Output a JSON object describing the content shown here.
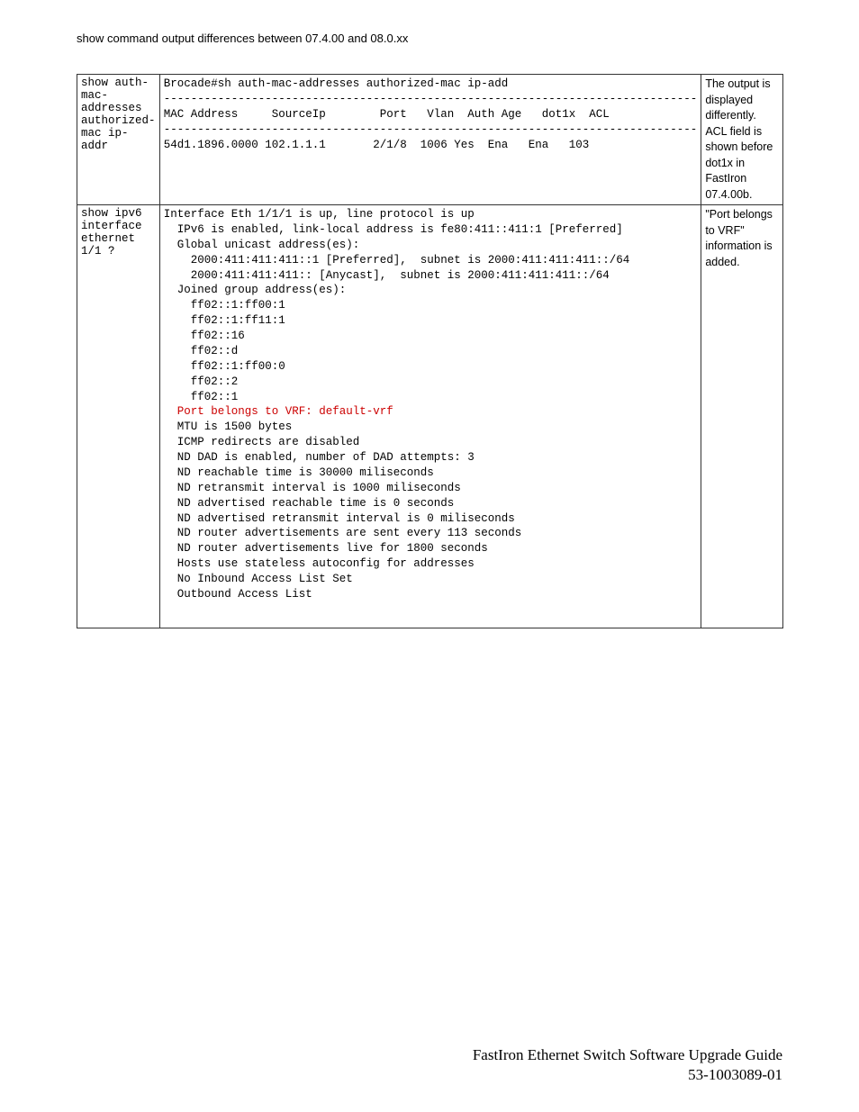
{
  "header": {
    "title": "show command output differences between 07.4.00 and 08.0.xx"
  },
  "rows": [
    {
      "command": "show auth-\nmac-\naddresses\nauthorized-\nmac ip-\naddr",
      "output_lines": [
        {
          "text": "Brocade#sh auth-mac-addresses authorized-mac ip-add",
          "red": false
        },
        {
          "text": "-------------------------------------------------------------------------------",
          "red": false
        },
        {
          "text": "MAC Address     SourceIp        Port   Vlan  Auth Age   dot1x  ACL",
          "red": false
        },
        {
          "text": "-------------------------------------------------------------------------------",
          "red": false
        },
        {
          "text": "54d1.1896.0000 102.1.1.1       2/1/8  1006 Yes  Ena   Ena   103",
          "red": false
        }
      ],
      "notes": "The output is displayed differently. ACL field is shown before dot1x in FastIron 07.4.00b."
    },
    {
      "command": "show ipv6\ninterface\nethernet\n1/1 ?",
      "output_lines": [
        {
          "text": "Interface Eth 1/1/1 is up, line protocol is up",
          "red": false
        },
        {
          "text": "  IPv6 is enabled, link-local address is fe80:411::411:1 [Preferred]",
          "red": false
        },
        {
          "text": "  Global unicast address(es):",
          "red": false
        },
        {
          "text": "    2000:411:411:411::1 [Preferred],  subnet is 2000:411:411:411::/64",
          "red": false
        },
        {
          "text": "    2000:411:411:411:: [Anycast],  subnet is 2000:411:411:411::/64",
          "red": false
        },
        {
          "text": "  Joined group address(es):",
          "red": false
        },
        {
          "text": "    ff02::1:ff00:1",
          "red": false
        },
        {
          "text": "    ff02::1:ff11:1",
          "red": false
        },
        {
          "text": "    ff02::16",
          "red": false
        },
        {
          "text": "    ff02::d",
          "red": false
        },
        {
          "text": "    ff02::1:ff00:0",
          "red": false
        },
        {
          "text": "    ff02::2",
          "red": false
        },
        {
          "text": "    ff02::1",
          "red": false
        },
        {
          "text": "  Port belongs to VRF: default-vrf",
          "red": true
        },
        {
          "text": "  MTU is 1500 bytes",
          "red": false
        },
        {
          "text": "  ICMP redirects are disabled",
          "red": false
        },
        {
          "text": "  ND DAD is enabled, number of DAD attempts: 3",
          "red": false
        },
        {
          "text": "  ND reachable time is 30000 miliseconds",
          "red": false
        },
        {
          "text": "  ND retransmit interval is 1000 miliseconds",
          "red": false
        },
        {
          "text": "  ND advertised reachable time is 0 seconds",
          "red": false
        },
        {
          "text": "  ND advertised retransmit interval is 0 miliseconds",
          "red": false
        },
        {
          "text": "  ND router advertisements are sent every 113 seconds",
          "red": false
        },
        {
          "text": "  ND router advertisements live for 1800 seconds",
          "red": false
        },
        {
          "text": "  Hosts use stateless autoconfig for addresses",
          "red": false
        },
        {
          "text": "  No Inbound Access List Set",
          "red": false
        },
        {
          "text": "  Outbound Access List",
          "red": false
        }
      ],
      "notes": "\"Port belongs to VRF\" information is added."
    }
  ],
  "footer": {
    "line1": "FastIron Ethernet Switch Software Upgrade Guide",
    "line2": "53-1003089-01"
  }
}
